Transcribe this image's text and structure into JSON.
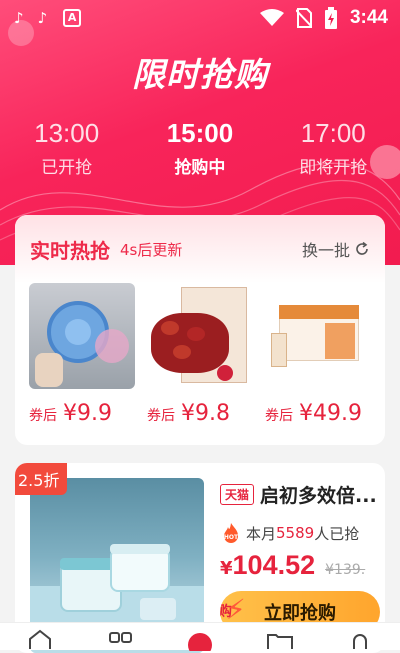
{
  "status_bar": {
    "time": "3:44",
    "icons": [
      "tiktok-icon",
      "tiktok-icon",
      "app-a-icon",
      "wifi-icon",
      "no-sim-icon",
      "battery-charging-icon"
    ],
    "app_a_letter": "A"
  },
  "hero": {
    "title": "限时抢购",
    "slots": [
      {
        "time": "13:00",
        "status": "已开抢"
      },
      {
        "time": "15:00",
        "status": "抢购中"
      },
      {
        "time": "17:00",
        "status": "即将开抢"
      }
    ]
  },
  "realtime": {
    "title": "实时热抢",
    "subtitle": "4s后更新",
    "refresh_label": "换一批",
    "products": [
      {
        "coupon_label": "券后",
        "price": "¥9.9",
        "image": "lint-filter-ball"
      },
      {
        "coupon_label": "券后",
        "price": "¥9.8",
        "image": "dried-red-dates"
      },
      {
        "coupon_label": "券后",
        "price": "¥49.9",
        "image": "milk-drink-box"
      }
    ]
  },
  "deal": {
    "discount": "2.5折",
    "store_badge": "天猫",
    "title": "启初多效倍...",
    "sold_prefix": "本月",
    "sold_count": "5589",
    "sold_suffix": "人已抢",
    "currency": "¥",
    "price": "104.52",
    "original_price": "¥139.",
    "buy_label": "立即抢购",
    "buy_badge": "购"
  },
  "tabbar": {
    "tabs": [
      "home-icon",
      "category-icon",
      "flash-sale-icon",
      "folder-icon",
      "profile-icon"
    ]
  },
  "colors": {
    "accent": "#f21c4f",
    "price_red": "#e6233d",
    "button_gold": "#ffb13a"
  }
}
